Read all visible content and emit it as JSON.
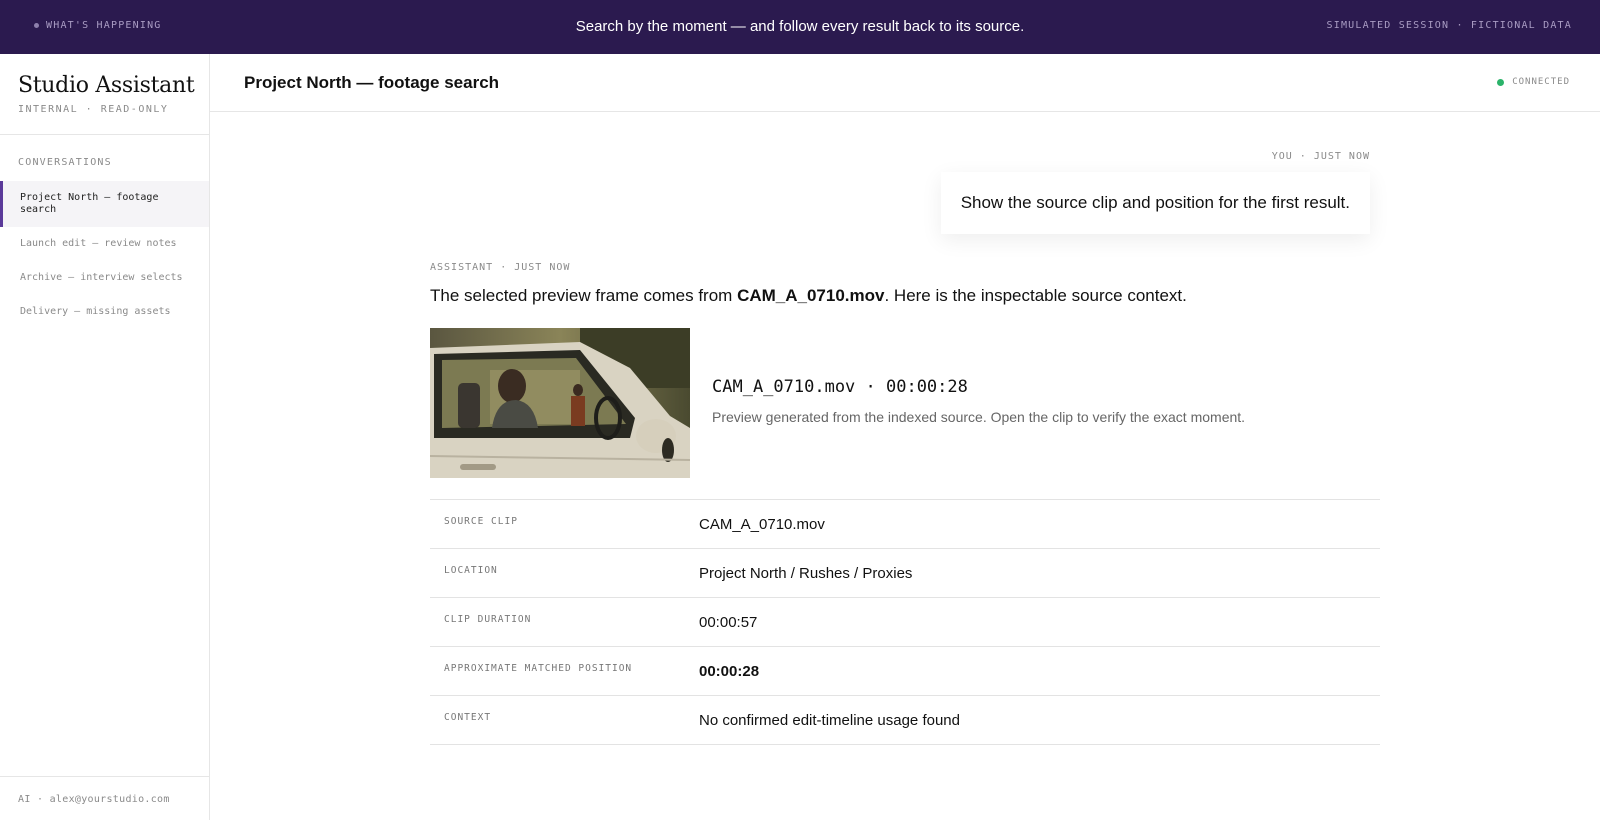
{
  "banner": {
    "label": "WHAT'S HAPPENING",
    "headline": "Search by the moment — and follow every result back to its source.",
    "session": "SIMULATED SESSION · FICTIONAL DATA"
  },
  "sidebar": {
    "app_name": "Studio Assistant",
    "app_sub": "INTERNAL · READ-ONLY",
    "conversations_heading": "CONVERSATIONS",
    "items": [
      {
        "label": "Project North — footage search",
        "active": true
      },
      {
        "label": "Launch edit — review notes",
        "active": false
      },
      {
        "label": "Archive — interview selects",
        "active": false
      },
      {
        "label": "Delivery — missing assets",
        "active": false
      }
    ],
    "footer": "AI · alex@yourstudio.com"
  },
  "header": {
    "title": "Project North — footage search",
    "status": "CONNECTED",
    "status_color": "#2bb36a"
  },
  "chat": {
    "user_meta": "YOU · JUST NOW",
    "user_message": "Show the source clip and position for the first result.",
    "assistant_meta": "ASSISTANT · JUST NOW",
    "assistant_prefix": "The selected preview frame comes from ",
    "assistant_clip": "CAM_A_0710.mov",
    "assistant_suffix": ". Here is the inspectable source context.",
    "preview": {
      "title": "CAM_A_0710.mov · 00:00:28",
      "note": "Preview generated from the indexed source. Open the clip to verify the exact moment."
    },
    "details": [
      {
        "key": "SOURCE CLIP",
        "value": "CAM_A_0710.mov"
      },
      {
        "key": "LOCATION",
        "value": "Project North / Rushes / Proxies"
      },
      {
        "key": "CLIP DURATION",
        "value": "00:00:57"
      },
      {
        "key": "APPROXIMATE MATCHED POSITION",
        "value": "00:00:28"
      },
      {
        "key": "CONTEXT",
        "value": "No confirmed edit-timeline usage found"
      }
    ]
  },
  "colors": {
    "banner_bg": "#2b1a4f",
    "accent": "#5b3a9a"
  }
}
